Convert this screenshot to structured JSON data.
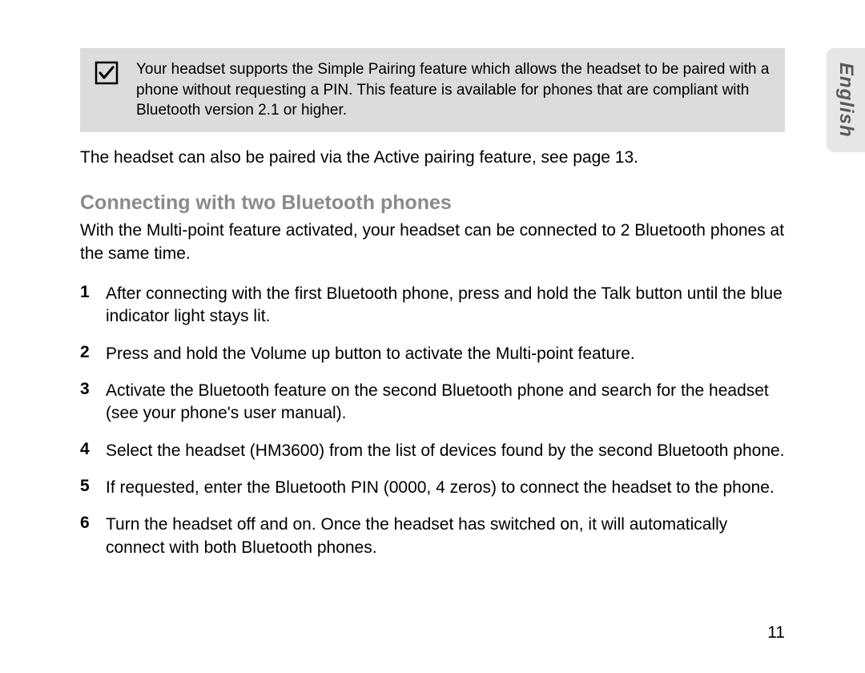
{
  "info_box": {
    "text": "Your headset supports the Simple Pairing feature which allows the headset to be paired with a phone without requesting a PIN. This feature is available for phones that are compliant with Bluetooth version 2.1 or higher."
  },
  "paragraph_after_box": "The headset can also be paired via the Active pairing feature, see page 13.",
  "section": {
    "heading": "Connecting with two Bluetooth phones",
    "intro": "With the Multi-point feature activated, your headset can be connected to 2 Bluetooth phones at the same time."
  },
  "steps": [
    {
      "num": "1",
      "text": "After connecting with the first Bluetooth phone, press and hold the Talk button until the blue indicator light stays lit."
    },
    {
      "num": "2",
      "text": "Press and hold the Volume up button to activate the Multi-point feature."
    },
    {
      "num": "3",
      "text": "Activate the Bluetooth feature on the second Bluetooth phone and search for the headset (see your phone's user manual)."
    },
    {
      "num": "4",
      "text": "Select the headset (HM3600) from the list of devices found by the second Bluetooth phone."
    },
    {
      "num": "5",
      "text": "If requested, enter the Bluetooth PIN (0000, 4 zeros) to connect the headset to the phone."
    },
    {
      "num": "6",
      "text": "Turn the headset off and on. Once the headset has switched on, it will automatically connect with both Bluetooth phones."
    }
  ],
  "side_tab": "English",
  "page_number": "11"
}
